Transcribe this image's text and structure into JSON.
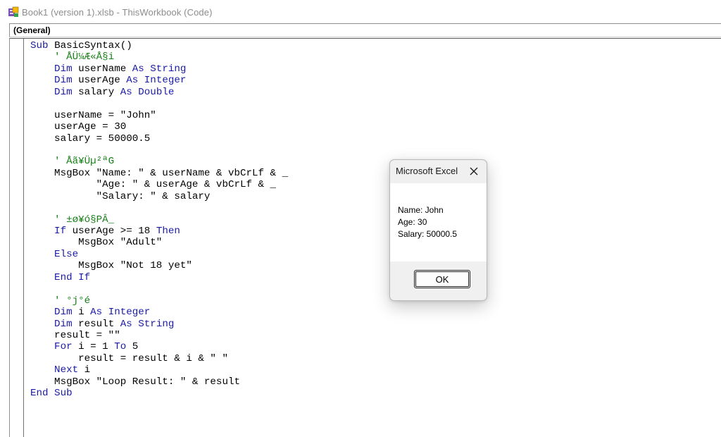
{
  "window": {
    "title": "Book1 (version 1).xlsb - ThisWorkbook (Code)"
  },
  "object_bar": {
    "selected": "(General)"
  },
  "code": {
    "lines": [
      [
        {
          "t": "Sub ",
          "c": "kw"
        },
        {
          "t": "BasicSyntax()",
          "c": ""
        }
      ],
      [
        {
          "t": "    ' ÅÜ¼Æ«Å§i",
          "c": "cm"
        }
      ],
      [
        {
          "t": "    Dim ",
          "c": "kw"
        },
        {
          "t": "userName ",
          "c": ""
        },
        {
          "t": "As String",
          "c": "kw"
        }
      ],
      [
        {
          "t": "    Dim ",
          "c": "kw"
        },
        {
          "t": "userAge ",
          "c": ""
        },
        {
          "t": "As Integer",
          "c": "kw"
        }
      ],
      [
        {
          "t": "    Dim ",
          "c": "kw"
        },
        {
          "t": "salary ",
          "c": ""
        },
        {
          "t": "As Double",
          "c": "kw"
        }
      ],
      [
        {
          "t": "",
          "c": ""
        }
      ],
      [
        {
          "t": "    userName = \"John\"",
          "c": ""
        }
      ],
      [
        {
          "t": "    userAge = 30",
          "c": ""
        }
      ],
      [
        {
          "t": "    salary = 50000.5",
          "c": ""
        }
      ],
      [
        {
          "t": "",
          "c": ""
        }
      ],
      [
        {
          "t": "    ' Åã¥Üµ²ªG",
          "c": "cm"
        }
      ],
      [
        {
          "t": "    MsgBox \"Name: \" & userName & vbCrLf & _",
          "c": ""
        }
      ],
      [
        {
          "t": "           \"Age: \" & userAge & vbCrLf & _",
          "c": ""
        }
      ],
      [
        {
          "t": "           \"Salary: \" & salary",
          "c": ""
        }
      ],
      [
        {
          "t": "",
          "c": ""
        }
      ],
      [
        {
          "t": "    ' ±ø¥ó§PÂ_",
          "c": "cm"
        }
      ],
      [
        {
          "t": "    If ",
          "c": "kw"
        },
        {
          "t": "userAge >= 18 ",
          "c": ""
        },
        {
          "t": "Then",
          "c": "kw"
        }
      ],
      [
        {
          "t": "        MsgBox \"Adult\"",
          "c": ""
        }
      ],
      [
        {
          "t": "    Else",
          "c": "kw"
        }
      ],
      [
        {
          "t": "        MsgBox \"Not 18 yet\"",
          "c": ""
        }
      ],
      [
        {
          "t": "    End If",
          "c": "kw"
        }
      ],
      [
        {
          "t": "",
          "c": ""
        }
      ],
      [
        {
          "t": "    ' °j°é",
          "c": "cm"
        }
      ],
      [
        {
          "t": "    Dim ",
          "c": "kw"
        },
        {
          "t": "i ",
          "c": ""
        },
        {
          "t": "As Integer",
          "c": "kw"
        }
      ],
      [
        {
          "t": "    Dim ",
          "c": "kw"
        },
        {
          "t": "result ",
          "c": ""
        },
        {
          "t": "As String",
          "c": "kw"
        }
      ],
      [
        {
          "t": "    result = \"\"",
          "c": ""
        }
      ],
      [
        {
          "t": "    For ",
          "c": "kw"
        },
        {
          "t": "i = 1 ",
          "c": ""
        },
        {
          "t": "To ",
          "c": "kw"
        },
        {
          "t": "5",
          "c": ""
        }
      ],
      [
        {
          "t": "        result = result & i & \" \"",
          "c": ""
        }
      ],
      [
        {
          "t": "    Next ",
          "c": "kw"
        },
        {
          "t": "i",
          "c": ""
        }
      ],
      [
        {
          "t": "    MsgBox \"Loop Result: \" & result",
          "c": ""
        }
      ],
      [
        {
          "t": "End Sub",
          "c": "kw"
        }
      ]
    ]
  },
  "dialog": {
    "title": "Microsoft Excel",
    "message_lines": [
      "Name: John",
      "Age: 30",
      "Salary: 50000.5"
    ],
    "ok_label": "OK"
  },
  "colors": {
    "keyword": "#1a1aa6",
    "comment": "#178017"
  }
}
